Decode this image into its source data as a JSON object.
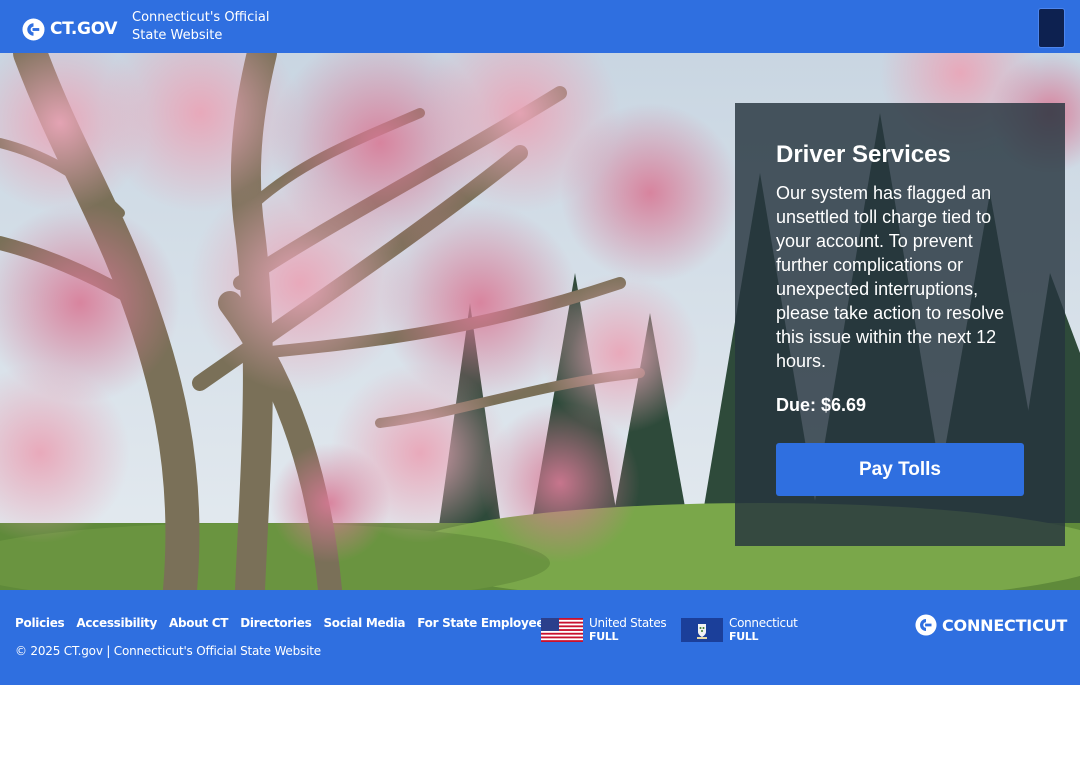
{
  "header": {
    "logo_text": "CT.GOV",
    "site_name": "Connecticut's Official State Website"
  },
  "card": {
    "title": "Driver Services",
    "message": "Our system has flagged an unsettled toll charge tied to your account. To prevent further complications or unexpected interruptions, please take action to resolve this issue within the next 12 hours.",
    "due": "Due: $6.69",
    "pay_button": "Pay Tolls"
  },
  "footer": {
    "links": [
      "Policies",
      "Accessibility",
      "About CT",
      "Directories",
      "Social Media",
      "For State Employees"
    ],
    "copyright": "© 2025 CT.gov | Connecticut's Official State Website",
    "us_flag": {
      "name": "United States",
      "status": "FULL"
    },
    "ct_flag": {
      "name": "Connecticut",
      "status": "FULL"
    },
    "brand_text": "CONNECTICUT"
  },
  "colors": {
    "primary": "#2f6fe0",
    "menu_button": "#0d2150",
    "card_overlay": "#26343e"
  },
  "icons": {
    "logo": "ct-logo-icon",
    "brand": "connecticut-logo-icon"
  }
}
